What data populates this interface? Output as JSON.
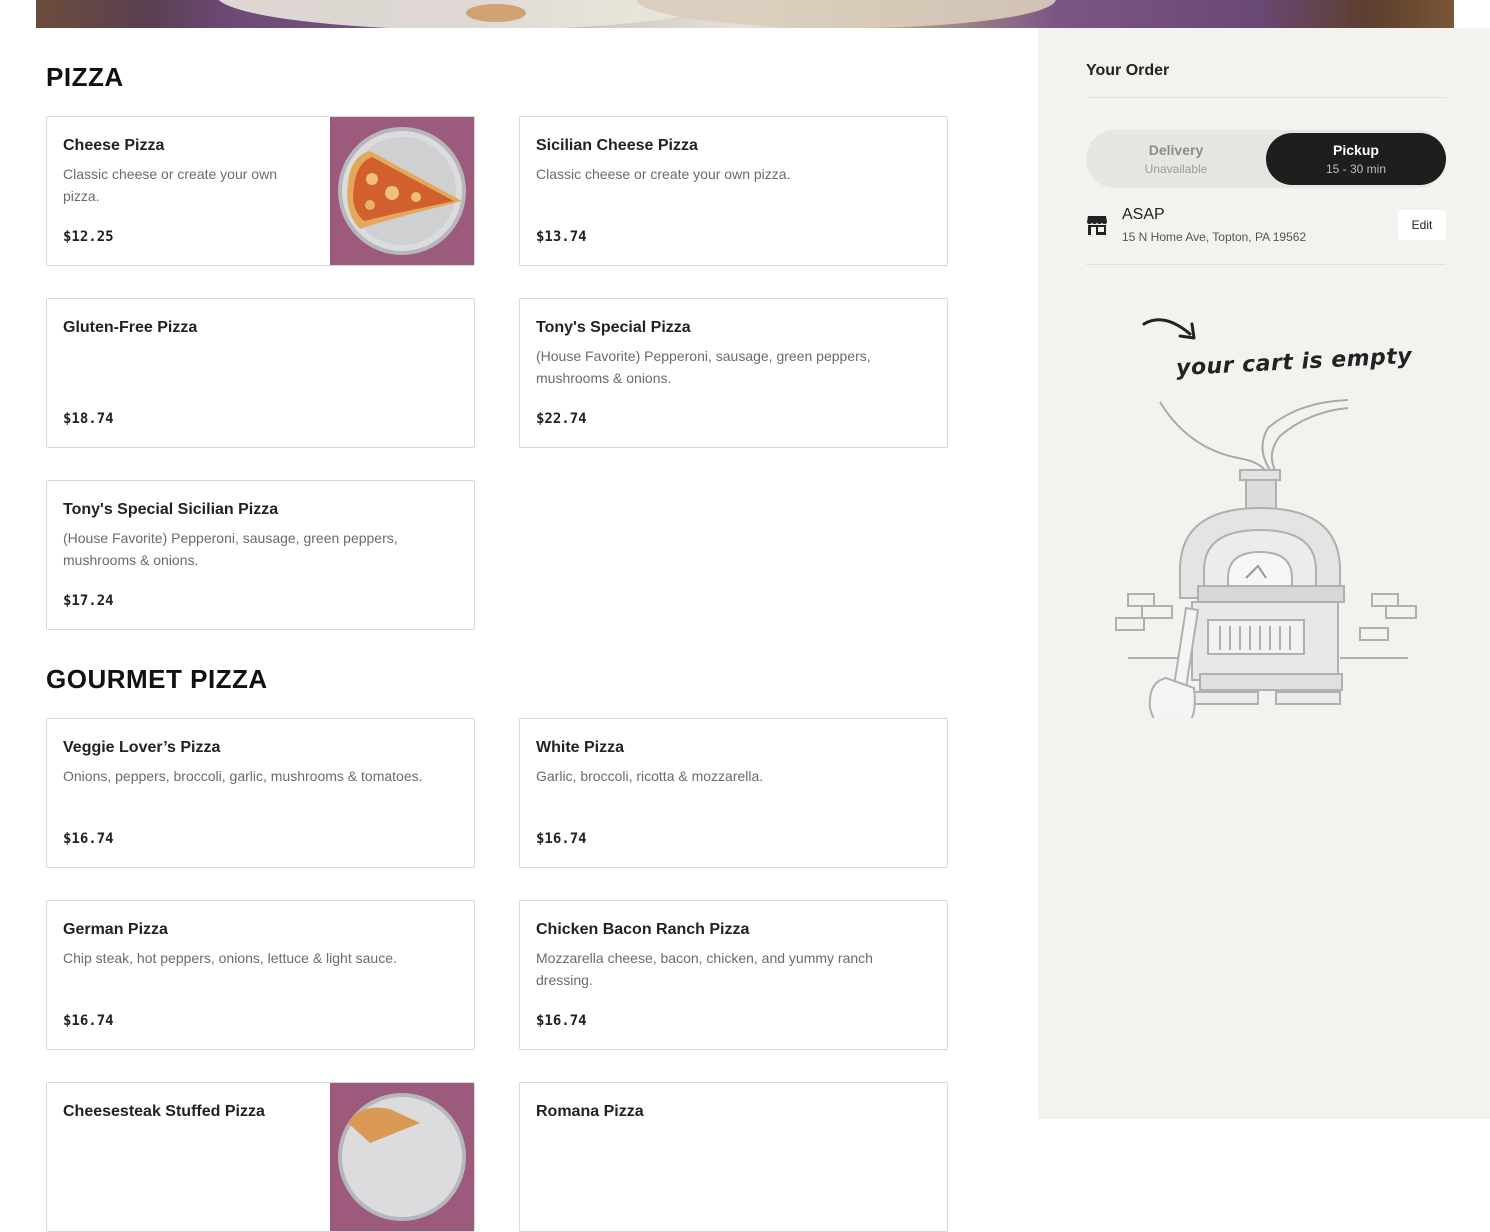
{
  "sections": [
    {
      "title": "PIZZA",
      "items": [
        {
          "name": "Cheese Pizza",
          "desc": "Classic cheese or create your own pizza.",
          "price": "$12.25"
        },
        {
          "name": "Sicilian Cheese Pizza",
          "desc": "Classic cheese or create your own pizza.",
          "price": "$13.74"
        },
        {
          "name": "Gluten-Free Pizza",
          "desc": "",
          "price": "$18.74"
        },
        {
          "name": "Tony's Special Pizza",
          "desc": "(House Favorite) Pepperoni, sausage, green peppers, mushrooms & onions.",
          "price": "$22.74"
        },
        {
          "name": "Tony's Special Sicilian Pizza",
          "desc": "(House Favorite) Pepperoni, sausage, green peppers, mushrooms & onions.",
          "price": "$17.24"
        }
      ]
    },
    {
      "title": "GOURMET PIZZA",
      "items": [
        {
          "name": "Veggie Lover’s Pizza",
          "desc": "Onions, peppers, broccoli, garlic, mushrooms & tomatoes.",
          "price": "$16.74"
        },
        {
          "name": "White Pizza",
          "desc": "Garlic, broccoli, ricotta & mozzarella.",
          "price": "$16.74"
        },
        {
          "name": "German Pizza",
          "desc": "Chip steak, hot peppers, onions, lettuce & light sauce.",
          "price": "$16.74"
        },
        {
          "name": "Chicken Bacon Ranch Pizza",
          "desc": "Mozzarella cheese, bacon, chicken, and yummy ranch dressing.",
          "price": "$16.74"
        },
        {
          "name": "Cheesesteak Stuffed Pizza"
        },
        {
          "name": "Romana Pizza"
        }
      ]
    }
  ],
  "order": {
    "title": "Your Order",
    "delivery_label": "Delivery",
    "delivery_status": "Unavailable",
    "pickup_label": "Pickup",
    "pickup_time": "15 - 30 min",
    "selected_mode": "Pickup",
    "when": "ASAP",
    "address": "15 N Home Ave, Topton, PA 19562",
    "edit_label": "Edit",
    "empty_message": "your cart is empty"
  },
  "icons": {
    "store": "store-icon",
    "arrow": "curved-arrow-icon",
    "illustration": "pizza-oven-illustration"
  },
  "colors": {
    "pickup_selected_bg": "#1e1e1e",
    "sidebar_bg": "#f3f2ef",
    "card_border": "#d9d9d9"
  }
}
